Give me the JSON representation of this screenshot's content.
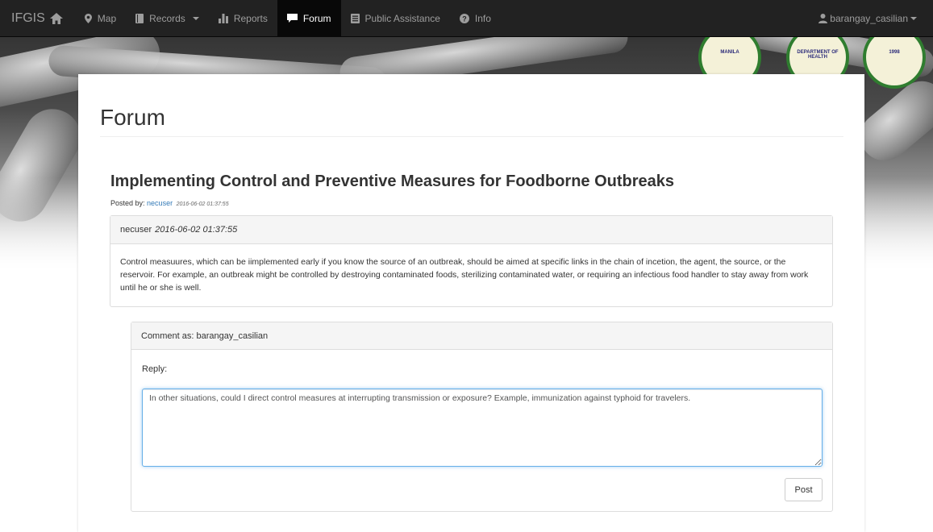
{
  "navbar": {
    "brand": "IFGIS",
    "items": [
      {
        "label": "Map",
        "icon": "map-marker-icon",
        "active": false,
        "dropdown": false
      },
      {
        "label": "Records",
        "icon": "book-icon",
        "active": false,
        "dropdown": true
      },
      {
        "label": "Reports",
        "icon": "bar-chart-icon",
        "active": false,
        "dropdown": false
      },
      {
        "label": "Forum",
        "icon": "comment-icon",
        "active": true,
        "dropdown": false
      },
      {
        "label": "Public Assistance",
        "icon": "list-alt-icon",
        "active": false,
        "dropdown": false
      },
      {
        "label": "Info",
        "icon": "question-sign-icon",
        "active": false,
        "dropdown": false
      }
    ],
    "user": "barangay_casilian"
  },
  "page": {
    "title": "Forum"
  },
  "thread": {
    "title": "Implementing Control and Preventive Measures for Foodborne Outbreaks",
    "posted_by_label": "Posted by:",
    "author": "necuser",
    "date": "2016-06-02 01:37:55"
  },
  "post": {
    "author": "necuser",
    "date": "2016-06-02 01:37:55",
    "body": "Control measuures, which can be iimplemented early if you know the source of an outbreak, should be aimed at specific links in the chain of incetion, the agent, the source, or the reservoir. For example, an outbreak might be controlled by destroying contaminated foods, sterilizing contaminated water, or requiring an infectious food handler to stay away from work until he or she is well."
  },
  "comment": {
    "heading": "Comment as: barangay_casilian",
    "reply_label": "Reply:",
    "reply_value": "In other situations, could I direct control measures at interrupting transmission or exposure? Example, immunization against typhoid for travelers.",
    "submit_label": "Post"
  },
  "colors": {
    "navbar_bg": "#222222",
    "navbar_active": "#080808",
    "link": "#337ab7",
    "focus_border": "#66afe9"
  }
}
